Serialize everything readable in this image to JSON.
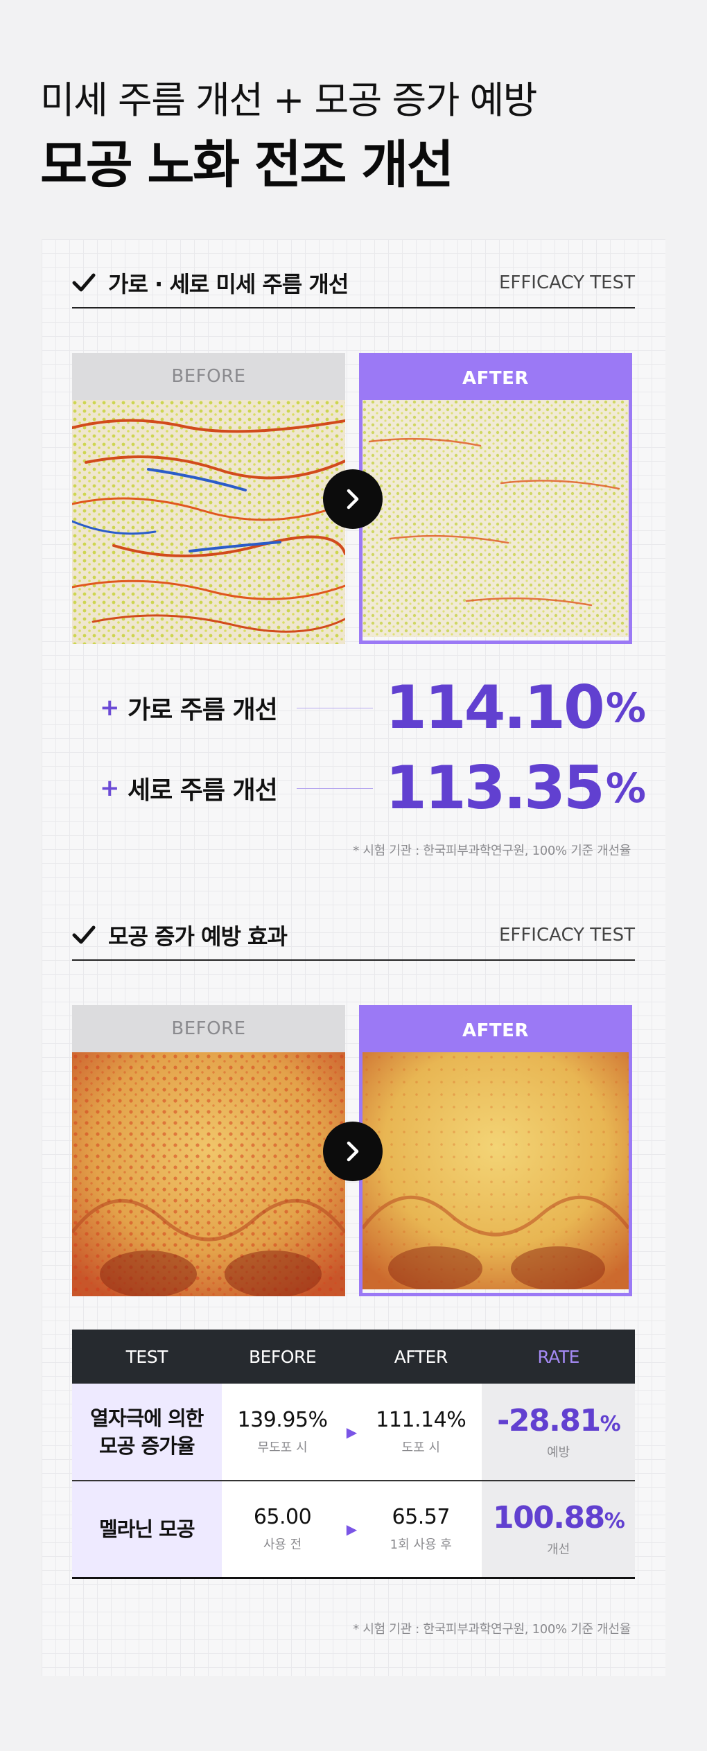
{
  "header": {
    "subtitle": "미세 주름 개선 + 모공 증가 예방",
    "title": "모공 노화 전조 개선"
  },
  "section1": {
    "title": "가로 · 세로 미세 주름 개선",
    "tag": "EFFICACY TEST",
    "before_label": "BEFORE",
    "after_label": "AFTER",
    "results": [
      {
        "plus": "+",
        "label": "가로 주름 개선",
        "value": "114.10",
        "unit": "%"
      },
      {
        "plus": "+",
        "label": "세로 주름 개선",
        "value": "113.35",
        "unit": "%"
      }
    ],
    "footnote": "* 시험 기관 : 한국피부과학연구원, 100% 기준 개선율"
  },
  "section2": {
    "title": "모공 증가 예방 효과",
    "tag": "EFFICACY TEST",
    "before_label": "BEFORE",
    "after_label": "AFTER",
    "table": {
      "headers": [
        "TEST",
        "BEFORE",
        "AFTER",
        "RATE"
      ],
      "rows": [
        {
          "test_line1": "열자극에 의한",
          "test_line2": "모공 증가율",
          "before": "139.95%",
          "before_sub": "무도포 시",
          "arrow": "▶",
          "after": "111.14%",
          "after_sub": "도포 시",
          "rate": "-28.81",
          "rate_unit": "%",
          "rate_sub": "예방"
        },
        {
          "test_line1": "멜라닌 모공",
          "test_line2": "",
          "before": "65.00",
          "before_sub": "사용 전",
          "arrow": "▶",
          "after": "65.57",
          "after_sub": "1회 사용 후",
          "rate": "100.88",
          "rate_unit": "%",
          "rate_sub": "개선"
        }
      ]
    },
    "footnote": "* 시험 기관 : 한국피부과학연구원, 100% 기준 개선율"
  },
  "colors": {
    "accent": "#6140d0",
    "after_border": "#9b79f5",
    "table_header": "#262a2f",
    "test_cell_bg": "#eeeaff"
  },
  "icons": [
    "check-icon",
    "chevron-right-icon",
    "triangle-right-icon"
  ]
}
